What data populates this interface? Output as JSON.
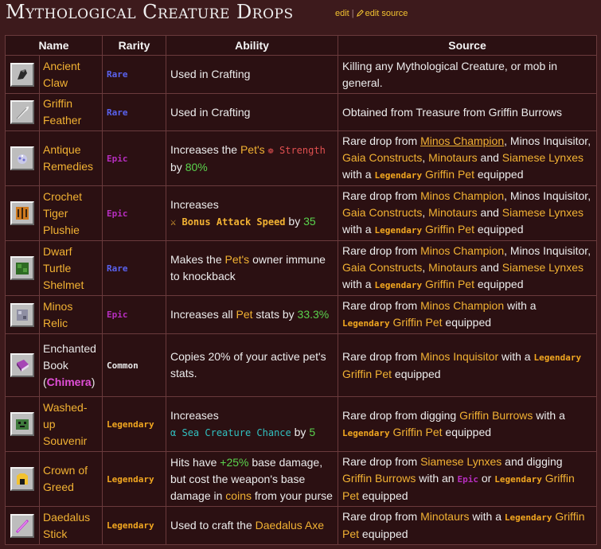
{
  "page": {
    "title": "Mythological Creature Drops",
    "edit": "edit",
    "edit_source": "edit source"
  },
  "table": {
    "headers": {
      "name": "Name",
      "rarity": "Rarity",
      "ability": "Ability",
      "source": "Source"
    }
  },
  "rows": [
    {
      "name": "Ancient Claw",
      "rarity": "Rare",
      "ability": "Used in Crafting",
      "source": "Killing any Mythological Creature, or mob in general.",
      "icon": "claw-icon"
    },
    {
      "name": "Griffin Feather",
      "rarity": "Rare",
      "ability": "Used in Crafting",
      "source": "Obtained from Treasure from Griffin Burrows",
      "icon": "feather-icon"
    },
    {
      "name": "Antique Remedies",
      "rarity": "Epic",
      "icon": "remedies-icon",
      "ability_parts": {
        "a": "Increases the ",
        "pet": "Pet's",
        "stat_icon": "❁",
        "stat": " Strength",
        "by": "by ",
        "value": "80%"
      }
    },
    {
      "name": "Crochet Tiger Plushie",
      "rarity": "Epic",
      "icon": "tiger-plushie-icon",
      "ability_parts": {
        "a": "Increases",
        "stat_icon": "⚔",
        "stat": " Bonus Attack Speed",
        "by": " by ",
        "value": "35"
      }
    },
    {
      "name": "Dwarf Turtle Shelmet",
      "rarity": "Rare",
      "icon": "turtle-shelmet-icon",
      "ability_parts": {
        "a": "Makes the ",
        "pet": "Pet's",
        "b": " owner immune to knockback"
      }
    },
    {
      "name": "Minos Relic",
      "rarity": "Epic",
      "icon": "relic-icon",
      "ability_parts": {
        "a": "Increases all ",
        "pet": "Pet",
        "b": " stats by ",
        "value": "33.3%"
      }
    },
    {
      "name_a": "Enchanted Book",
      "name_paren_open": "(",
      "name_b": "Chimera",
      "name_paren_close": ")",
      "rarity": "Common",
      "icon": "enchanted-book-icon",
      "ability": "Copies 20% of your active pet's stats."
    },
    {
      "name": "Washed-up Souvenir",
      "rarity": "Legendary",
      "icon": "souvenir-icon",
      "ability_parts": {
        "a": "Increases",
        "stat_icon": "α",
        "stat": " Sea Creature Chance",
        "by": " by ",
        "value": "5"
      }
    },
    {
      "name": "Crown of Greed",
      "rarity": "Legendary",
      "icon": "crown-icon",
      "ability_parts": {
        "a": "Hits have ",
        "value": "+25%",
        "b": " base damage, but cost the weapon's base damage in ",
        "coins": "coins",
        "c": " from your purse"
      }
    },
    {
      "name": "Daedalus Stick",
      "rarity": "Legendary",
      "icon": "stick-icon",
      "ability_parts": {
        "a": "Used to craft the ",
        "item": "Daedalus Axe"
      }
    }
  ],
  "sources": {
    "rare_drop_from": "Rare drop from ",
    "minos_champion": "Minos Champion",
    "minos_inquisitor": "Minos Inquisitor",
    "gaia_constructs": "Gaia Constructs",
    "minotaurs": "Minotaurs",
    "siamese_lynxes": "Siamese Lynxes",
    "griffin_pet": "Griffin Pet",
    "griffin_burrows": "Griffin Burrows",
    "legendary": "Legendary",
    "epic": "Epic",
    "comma": ", ",
    "and": " and ",
    "with_a": " with a ",
    "with_a_start": "with a ",
    "equipped": " equipped",
    "rare_drop_from_digging": "Rare drop from digging ",
    "and_digging": " and digging ",
    "with_an": " with an ",
    "or": " or ",
    "pet_word": "Pet"
  },
  "colors": {
    "rare": "#5a63f0",
    "epic": "#b72ec0",
    "legendary": "#f2a720",
    "gold": "#f2b233",
    "green": "#5ad34d"
  }
}
